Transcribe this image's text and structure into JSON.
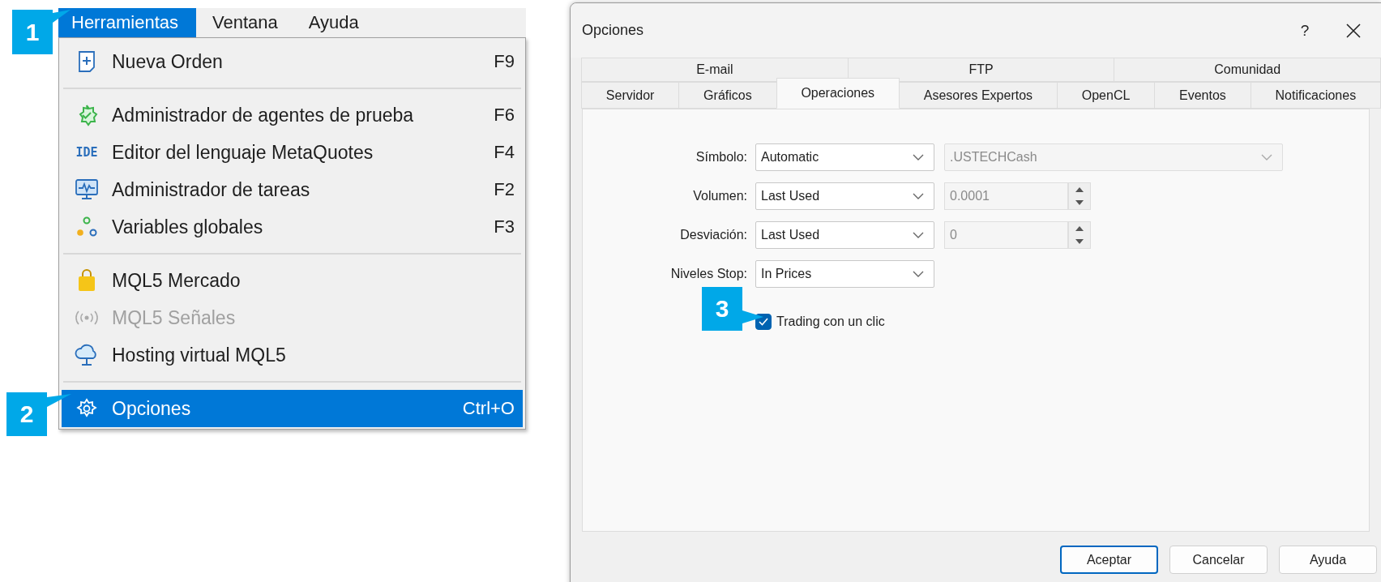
{
  "menubar": {
    "items": [
      {
        "label": "Herramientas",
        "selected": true
      },
      {
        "label": "Ventana",
        "selected": false
      },
      {
        "label": "Ayuda",
        "selected": false
      }
    ]
  },
  "menu": {
    "groups": [
      [
        {
          "label": "Nueva Orden",
          "shortcut": "F9",
          "disabled": false,
          "selected": false
        }
      ],
      [
        {
          "label": "Administrador de agentes de prueba",
          "shortcut": "F6",
          "disabled": false,
          "selected": false
        },
        {
          "label": "Editor del lenguaje MetaQuotes",
          "shortcut": "F4",
          "icon_text": "IDE",
          "disabled": false,
          "selected": false
        },
        {
          "label": "Administrador de tareas",
          "shortcut": "F2",
          "disabled": false,
          "selected": false
        },
        {
          "label": "Variables globales",
          "shortcut": "F3",
          "disabled": false,
          "selected": false
        }
      ],
      [
        {
          "label": "MQL5 Mercado",
          "disabled": false,
          "selected": false
        },
        {
          "label": "MQL5 Señales",
          "disabled": true,
          "selected": false
        },
        {
          "label": "Hosting virtual MQL5",
          "disabled": false,
          "selected": false
        }
      ],
      [
        {
          "label": "Opciones",
          "shortcut": "Ctrl+O",
          "disabled": false,
          "selected": true
        }
      ]
    ]
  },
  "callouts": [
    "1",
    "2",
    "3"
  ],
  "dialog": {
    "title": "Opciones",
    "help": "?",
    "tab_rows": [
      [
        {
          "label": "E-mail",
          "selected": false
        },
        {
          "label": "FTP",
          "selected": false
        },
        {
          "label": "Comunidad",
          "selected": false
        }
      ],
      [
        {
          "label": "Servidor",
          "selected": false
        },
        {
          "label": "Gráficos",
          "selected": false
        },
        {
          "label": "Operaciones",
          "selected": true
        },
        {
          "label": "Asesores Expertos",
          "selected": false
        },
        {
          "label": "OpenCL",
          "selected": false
        },
        {
          "label": "Eventos",
          "selected": false
        },
        {
          "label": "Notificaciones",
          "selected": false
        }
      ]
    ],
    "fields": [
      {
        "label": "Símbolo:",
        "value": "Automatic",
        "extra": {
          "kind": "select",
          "value": ".USTECHCash",
          "disabled": true
        }
      },
      {
        "label": "Volumen:",
        "value": "Last Used",
        "extra": {
          "kind": "spin",
          "value": "0.0001",
          "disabled": true
        }
      },
      {
        "label": "Desviación:",
        "value": "Last Used",
        "extra": {
          "kind": "spin",
          "value": "0",
          "disabled": true
        }
      },
      {
        "label": "Niveles Stop:",
        "value": "In Prices"
      }
    ],
    "checkbox": {
      "label": "Trading con un clic",
      "checked": true
    },
    "buttons": [
      {
        "label": "Aceptar",
        "default": true
      },
      {
        "label": "Cancelar",
        "default": false
      },
      {
        "label": "Ayuda",
        "default": false
      }
    ]
  }
}
